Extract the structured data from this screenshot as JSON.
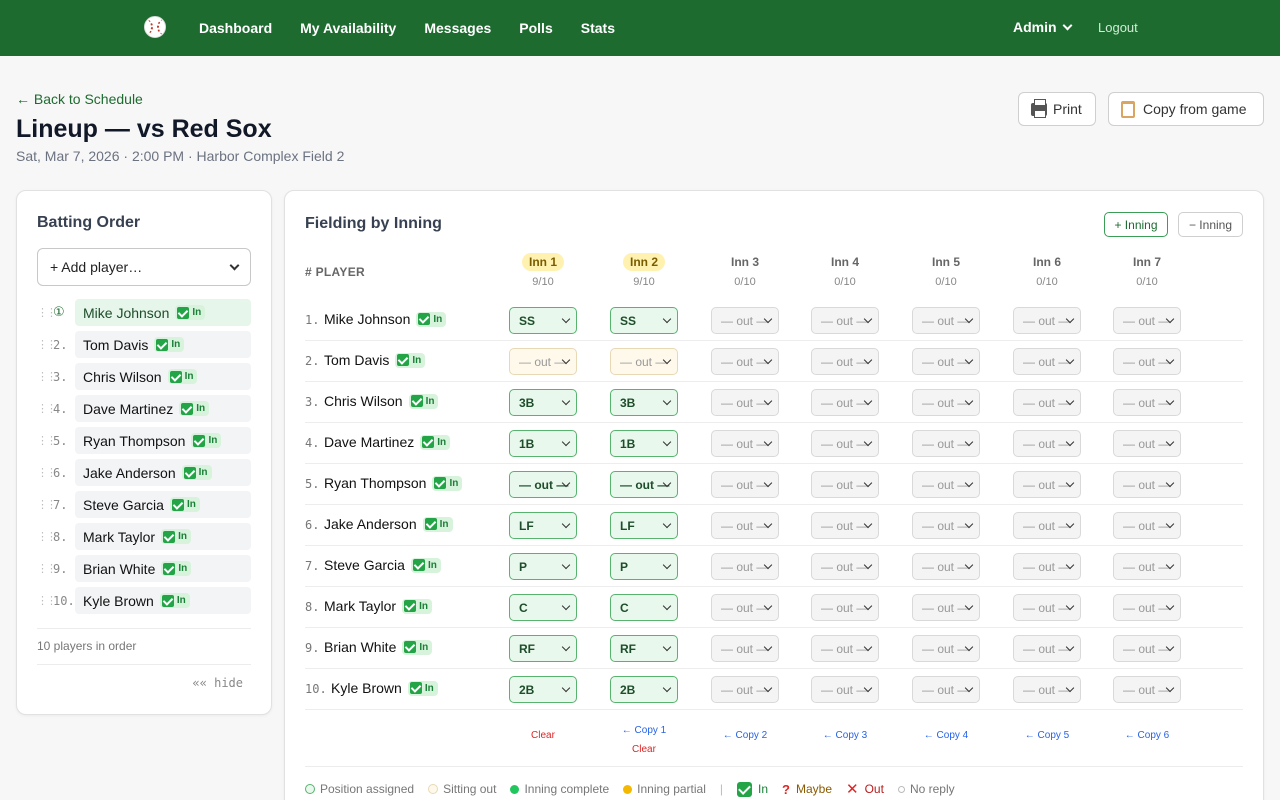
{
  "nav": {
    "links": [
      "Dashboard",
      "My Availability",
      "Messages",
      "Polls",
      "Stats"
    ],
    "user": "Admin",
    "logout": "Logout"
  },
  "header": {
    "back": "← Back to Schedule",
    "title": "Lineup — vs Red Sox",
    "subtitle": "Sat, Mar 7, 2026 · 2:00 PM · Harbor Complex Field 2",
    "print": "Print",
    "copy_from_game": "Copy from game"
  },
  "batting": {
    "title": "Batting Order",
    "add_placeholder": "+ Add player…",
    "first_marker": "①",
    "players": [
      {
        "num": "1.",
        "name": "Mike Johnson",
        "status": "In"
      },
      {
        "num": "2.",
        "name": "Tom Davis",
        "status": "In"
      },
      {
        "num": "3.",
        "name": "Chris Wilson",
        "status": "In"
      },
      {
        "num": "4.",
        "name": "Dave Martinez",
        "status": "In"
      },
      {
        "num": "5.",
        "name": "Ryan Thompson",
        "status": "In"
      },
      {
        "num": "6.",
        "name": "Jake Anderson",
        "status": "In"
      },
      {
        "num": "7.",
        "name": "Steve Garcia",
        "status": "In"
      },
      {
        "num": "8.",
        "name": "Mark Taylor",
        "status": "In"
      },
      {
        "num": "9.",
        "name": "Brian White",
        "status": "In"
      },
      {
        "num": "10.",
        "name": "Kyle Brown",
        "status": "In"
      }
    ],
    "count_text": "10 players in order",
    "hide": "«« hide"
  },
  "fielding": {
    "title": "Fielding by Inning",
    "add_inning": "+ Inning",
    "remove_inning": "− Inning",
    "player_header": "# PLAYER",
    "out_label": "— out —",
    "innings": [
      {
        "label": "Inn 1",
        "count": "9/10",
        "state": "partial"
      },
      {
        "label": "Inn 2",
        "count": "9/10",
        "state": "partial"
      },
      {
        "label": "Inn 3",
        "count": "0/10",
        "state": "empty"
      },
      {
        "label": "Inn 4",
        "count": "0/10",
        "state": "empty"
      },
      {
        "label": "Inn 5",
        "count": "0/10",
        "state": "empty"
      },
      {
        "label": "Inn 6",
        "count": "0/10",
        "state": "empty"
      },
      {
        "label": "Inn 7",
        "count": "0/10",
        "state": "empty"
      }
    ],
    "rows": [
      {
        "num": "1.",
        "name": "Mike Johnson",
        "status": "In",
        "positions": [
          "SS",
          "SS"
        ]
      },
      {
        "num": "2.",
        "name": "Tom Davis",
        "status": "In",
        "positions": [
          "— out —",
          "— out —"
        ]
      },
      {
        "num": "3.",
        "name": "Chris Wilson",
        "status": "In",
        "positions": [
          "3B",
          "3B"
        ]
      },
      {
        "num": "4.",
        "name": "Dave Martinez",
        "status": "In",
        "positions": [
          "1B",
          "1B"
        ]
      },
      {
        "num": "5.",
        "name": "Ryan Thompson",
        "status": "In",
        "positions": [
          "— out —",
          "— out —"
        ]
      },
      {
        "num": "6.",
        "name": "Jake Anderson",
        "status": "In",
        "positions": [
          "LF",
          "LF"
        ]
      },
      {
        "num": "7.",
        "name": "Steve Garcia",
        "status": "In",
        "positions": [
          "P",
          "P"
        ]
      },
      {
        "num": "8.",
        "name": "Mark Taylor",
        "status": "In",
        "positions": [
          "C",
          "C"
        ]
      },
      {
        "num": "9.",
        "name": "Brian White",
        "status": "In",
        "positions": [
          "RF",
          "RF"
        ]
      },
      {
        "num": "10.",
        "name": "Kyle Brown",
        "status": "In",
        "positions": [
          "2B",
          "2B"
        ]
      }
    ],
    "footer": [
      {
        "copy": "",
        "clear": "Clear"
      },
      {
        "copy": "← Copy 1",
        "clear": "Clear"
      },
      {
        "copy": "← Copy 2",
        "clear": ""
      },
      {
        "copy": "← Copy 3",
        "clear": ""
      },
      {
        "copy": "← Copy 4",
        "clear": ""
      },
      {
        "copy": "← Copy 5",
        "clear": ""
      },
      {
        "copy": "← Copy 6",
        "clear": ""
      }
    ]
  },
  "legend": {
    "assigned": "Position assigned",
    "sitting": "Sitting out",
    "complete": "Inning complete",
    "partial": "Inning partial",
    "in": "In",
    "maybe": "Maybe",
    "out": "Out",
    "no_reply": "No reply"
  },
  "colors": {
    "nav": "#1e6b30",
    "assigned_border": "#58b36f",
    "partial_badge": "#fff2b0",
    "copy_link": "#2563eb",
    "clear_link": "#dc2626"
  }
}
